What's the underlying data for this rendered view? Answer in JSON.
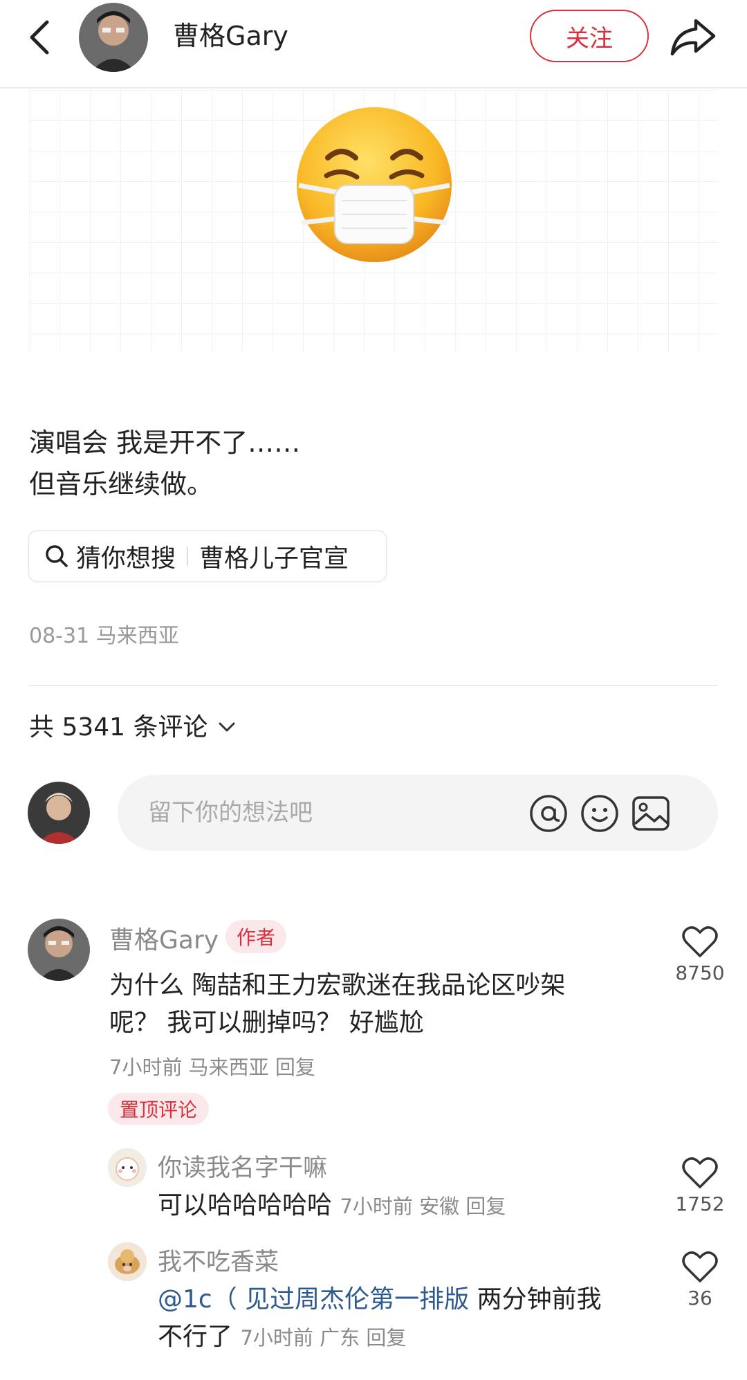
{
  "header": {
    "name": "曹格Gary",
    "follow_label": "关注"
  },
  "post": {
    "line1": "演唱会 我是开不了……",
    "line2": "但音乐继续做。",
    "search_prefix": "猜你想搜",
    "search_term": "曹格儿子官宣",
    "meta": "08-31 马来西亚"
  },
  "comments_header": {
    "count_text": "共 5341 条评论"
  },
  "composer": {
    "placeholder": "留下你的想法吧"
  },
  "comments": [
    {
      "name": "曹格Gary",
      "badge": "作者",
      "text_line1": "为什么 陶喆和王力宏歌迷在我品论区吵架",
      "text_line2": "呢？ 我可以删掉吗？  好尴尬",
      "meta": "7小时前 马来西亚 回复",
      "pin": "置顶评论",
      "likes": "8750"
    }
  ],
  "replies": [
    {
      "name": "你读我名字干嘛",
      "text": "可以哈哈哈哈哈",
      "meta": "7小时前 安徽  回复",
      "likes": "1752"
    },
    {
      "name": "我不吃香菜",
      "mention": "@1c（ 见过周杰伦第一排版",
      "text_a": "  两分钟前我",
      "text_b": "不行了",
      "meta": "7小时前 广东  回复",
      "likes": "36"
    }
  ],
  "colors": {
    "accent": "#d9303e",
    "muted": "#8a8a8a",
    "mention": "#2f5a8f"
  }
}
